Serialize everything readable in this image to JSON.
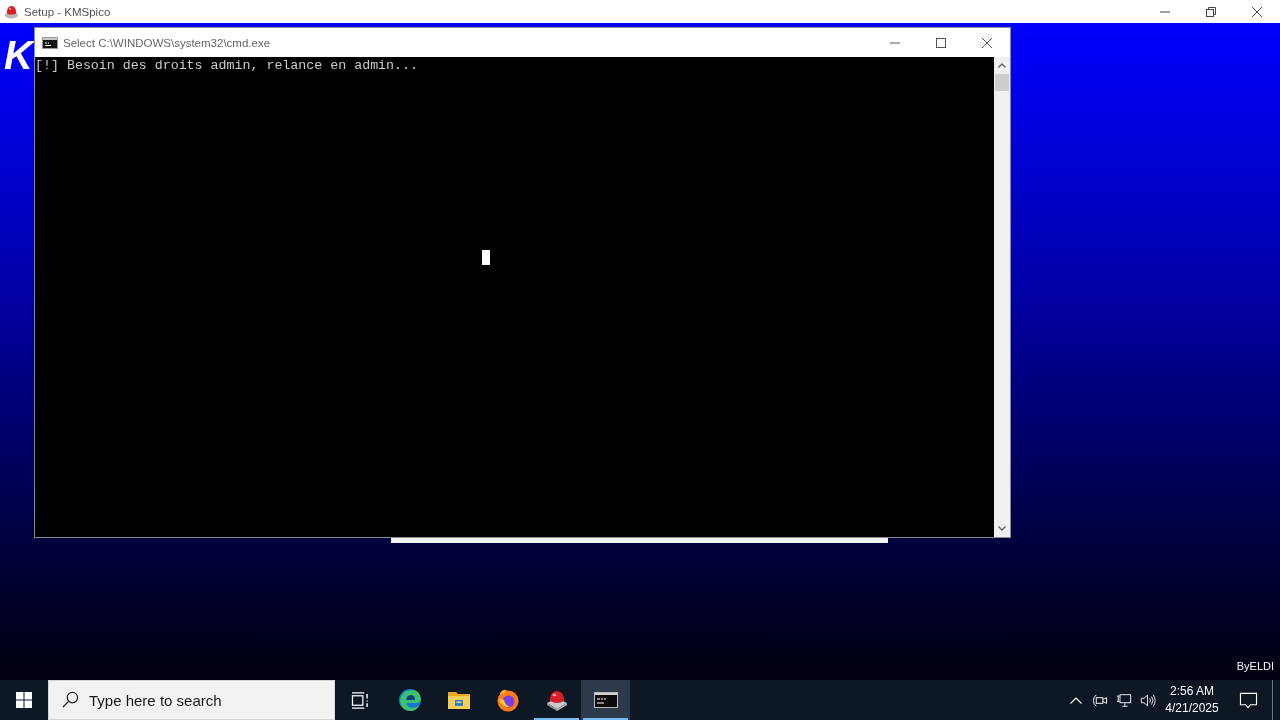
{
  "setup_window": {
    "title": "Setup - KMSpico",
    "logo_letter": "K",
    "credit": "ByELDI"
  },
  "console_window": {
    "title": "Select C:\\WINDOWS\\system32\\cmd.exe",
    "lines": [
      "[!] Besoin des droits admin, relance en admin..."
    ]
  },
  "taskbar": {
    "search": {
      "placeholder": "Type here to search"
    },
    "apps": [
      {
        "kind": "swirl",
        "open": false,
        "active": false
      },
      {
        "kind": "folder",
        "open": false,
        "active": false
      },
      {
        "kind": "fox",
        "open": false,
        "active": false
      },
      {
        "kind": "dome",
        "open": true,
        "active": false
      },
      {
        "kind": "terminal",
        "open": true,
        "active": true
      }
    ],
    "clock": {
      "time": "2:56 AM",
      "date": "4/21/2025"
    }
  }
}
